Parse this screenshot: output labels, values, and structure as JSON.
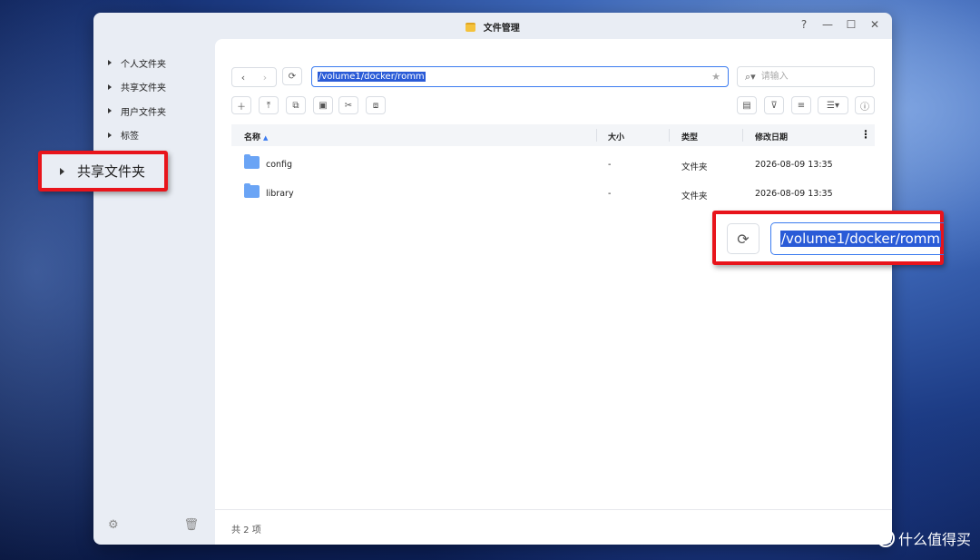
{
  "window": {
    "title": "文件管理",
    "controls": {
      "help": "?",
      "minimize": "—",
      "maximize": "☐",
      "close": "✕"
    }
  },
  "sidebar": {
    "items": [
      {
        "label": "个人文件夹"
      },
      {
        "label": "共享文件夹"
      },
      {
        "label": "用户文件夹"
      },
      {
        "label": "标签"
      }
    ],
    "bottom_icons": [
      "settings-icon",
      "trash-icon"
    ]
  },
  "toolbar": {
    "back": "‹",
    "forward": "›",
    "refresh": "⟳",
    "path": "/volume1/docker/romm",
    "favorite": "★",
    "search_placeholder": "请输入",
    "action_icons": [
      "new-icon",
      "upload-icon",
      "copy-icon",
      "paste-icon",
      "cut-icon",
      "share-icon"
    ],
    "right_icons": [
      "archive-icon",
      "filter-icon",
      "sort-icon",
      "view-mode-icon",
      "info-icon"
    ]
  },
  "table": {
    "columns": [
      "名称",
      "大小",
      "类型",
      "修改日期"
    ],
    "rows": [
      {
        "name": "config",
        "size": "-",
        "type": "文件夹",
        "modified": "2026-08-09 13:35"
      },
      {
        "name": "library",
        "size": "-",
        "type": "文件夹",
        "modified": "2026-08-09 13:35"
      }
    ]
  },
  "footer": {
    "count": "共 2 项"
  },
  "callouts": {
    "left_label": "共享文件夹",
    "right_path": "/volume1/docker/romm"
  },
  "watermark": {
    "logo": "值",
    "text": "什么值得买"
  }
}
